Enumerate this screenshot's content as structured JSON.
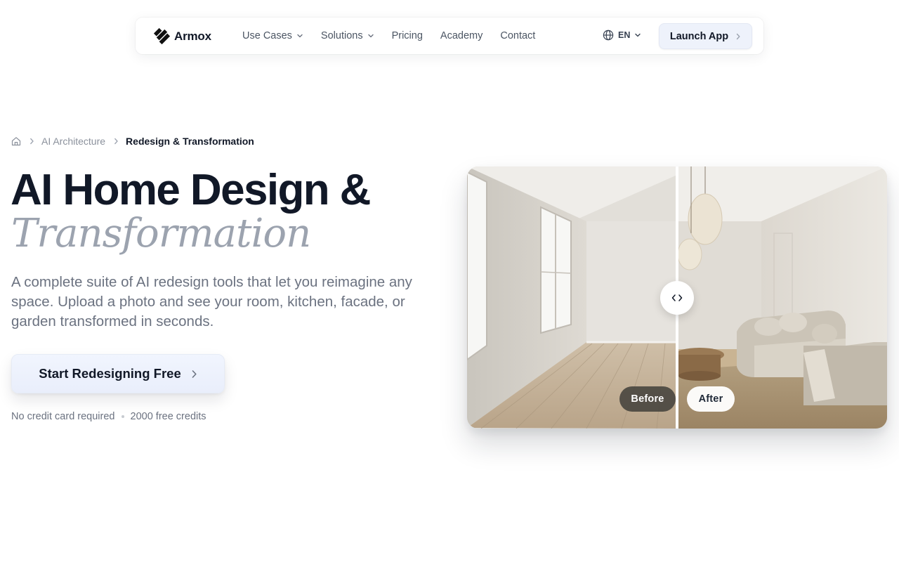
{
  "nav": {
    "logo_text": "Armox",
    "links": [
      {
        "label": "Use Cases",
        "has_dropdown": true
      },
      {
        "label": "Solutions",
        "has_dropdown": true
      },
      {
        "label": "Pricing",
        "has_dropdown": false
      },
      {
        "label": "Academy",
        "has_dropdown": false
      },
      {
        "label": "Contact",
        "has_dropdown": false
      }
    ],
    "language": "EN",
    "launch_label": "Launch App"
  },
  "breadcrumb": {
    "items": [
      "AI Architecture",
      "Redesign & Transformation"
    ]
  },
  "hero": {
    "title_line1": "AI Home Design &",
    "title_line2": "Transformation",
    "lead": "A complete suite of AI redesign tools that let you reimagine any space. Upload a photo and see your room, kitchen, facade, or garden transformed in seconds.",
    "cta_label": "Start Redesigning Free",
    "note_items": [
      "No credit card required",
      "2000 free credits"
    ]
  },
  "compare": {
    "before_label": "Before",
    "after_label": "After",
    "divider_position": 0.5
  },
  "colors": {
    "text_primary": "#111827",
    "text_muted": "#6b7280",
    "title_accent": "#9ca3af",
    "cta_bg": "#eef2fb"
  },
  "icons": {
    "logo": "armox-logo-icon",
    "home": "home-icon",
    "globe": "globe-icon",
    "chevron": "chevron-down-icon",
    "arrow": "chevron-right-icon",
    "compare_handle": "code-arrows-icon"
  }
}
